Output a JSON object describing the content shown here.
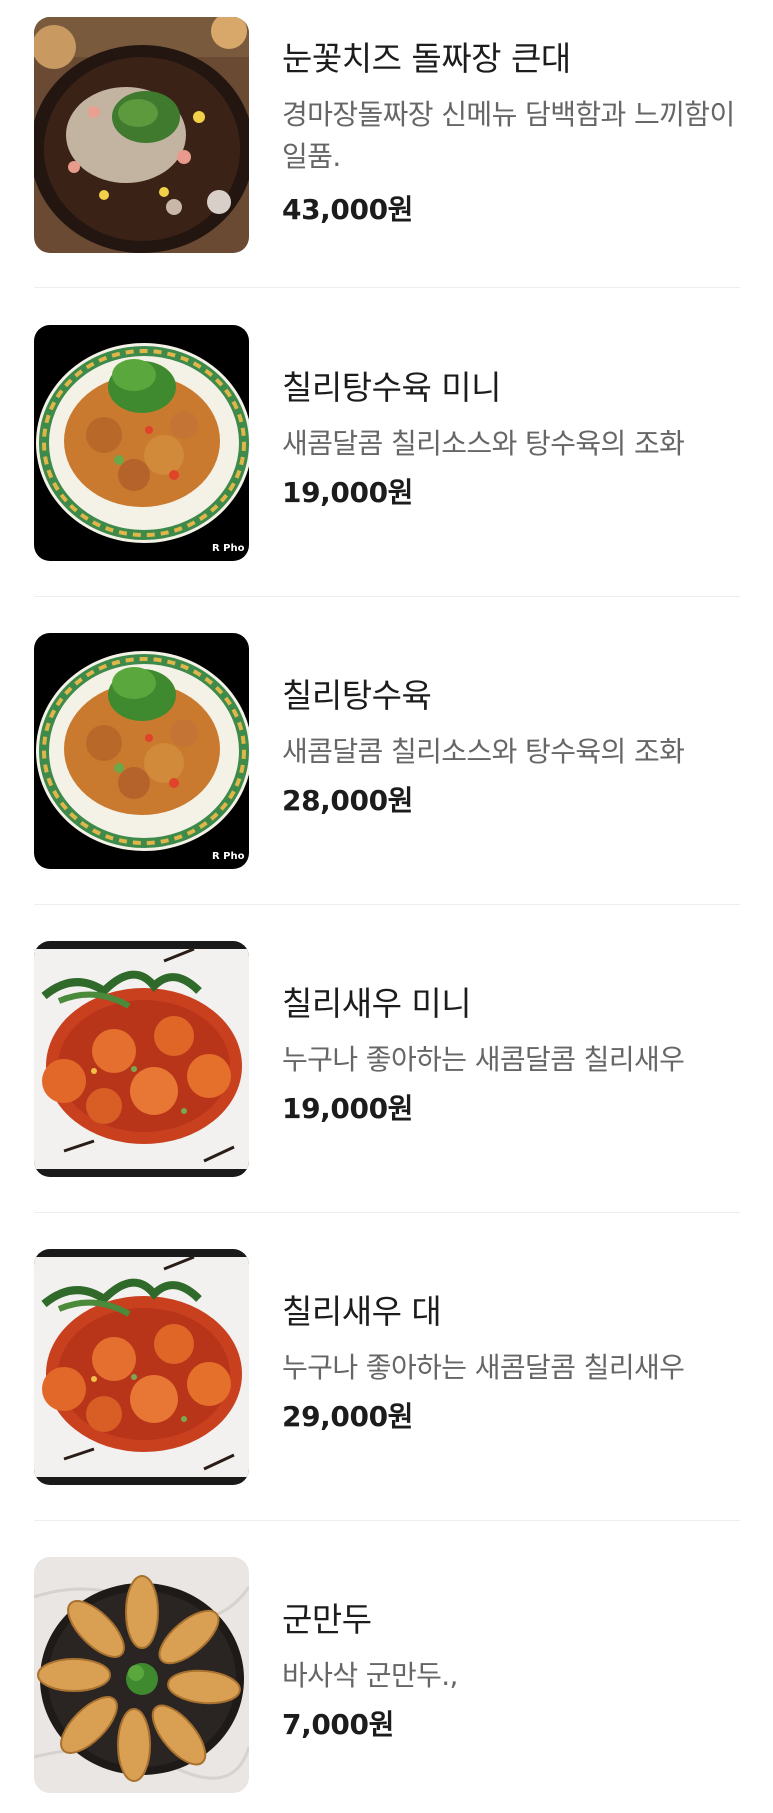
{
  "menu": {
    "items": [
      {
        "name": "눈꽃치즈 돌짜장 큰대",
        "description": "경마장돌짜장 신메뉴 담백함과 느끼함이 일품.",
        "price": "43,000원",
        "image": "cheese-jjajang-photo"
      },
      {
        "name": "칠리탕수육 미니",
        "description": "새콤달콤 칠리소스와 탕수육의 조화",
        "price": "19,000원",
        "image": "chili-tangsuyuk-photo"
      },
      {
        "name": "칠리탕수육",
        "description": "새콤달콤 칠리소스와 탕수육의 조화",
        "price": "28,000원",
        "image": "chili-tangsuyuk-photo"
      },
      {
        "name": "칠리새우 미니",
        "description": "누구나 좋아하는 새콤달콤 칠리새우",
        "price": "19,000원",
        "image": "chili-shrimp-photo"
      },
      {
        "name": "칠리새우 대",
        "description": "누구나 좋아하는 새콤달콤 칠리새우",
        "price": "29,000원",
        "image": "chili-shrimp-photo"
      },
      {
        "name": "군만두",
        "description": "바사삭 군만두.,",
        "price": "7,000원",
        "image": "fried-dumpling-photo"
      }
    ]
  },
  "colors": {
    "text_primary": "#1c1c1c",
    "text_secondary": "#666666",
    "divider": "#eeeeee"
  }
}
